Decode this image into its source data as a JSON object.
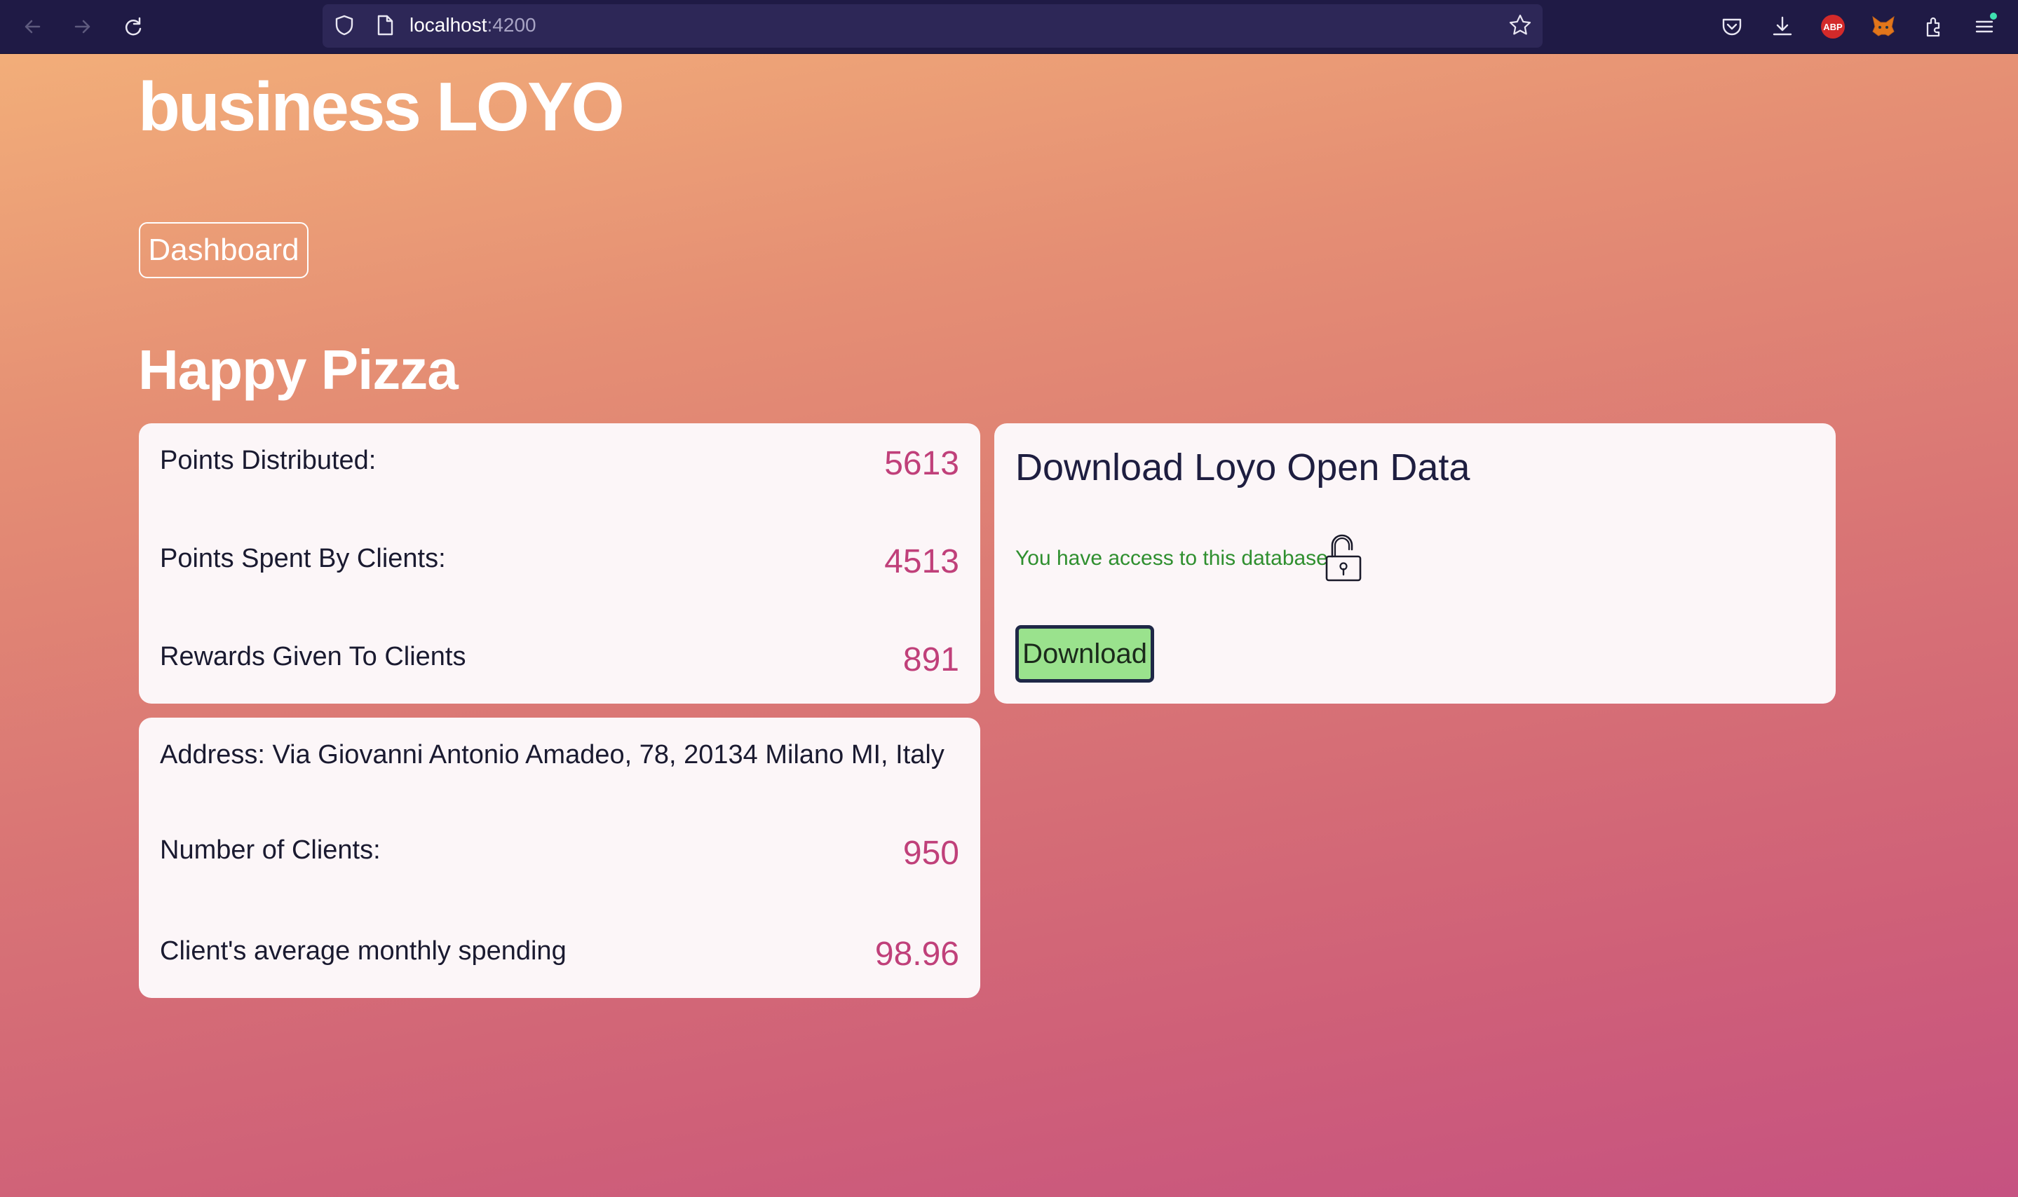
{
  "browser": {
    "url_host": "localhost",
    "url_port": ":4200",
    "icons": [
      "back-icon",
      "forward-icon",
      "reload-icon",
      "shield-icon",
      "page-icon",
      "star-icon",
      "pocket-icon",
      "download-icon",
      "adblock-icon",
      "fox-icon",
      "extensions-icon",
      "menu-icon"
    ],
    "adblock_label": "ABP"
  },
  "page": {
    "brand": "business LOYO",
    "dashboard_label": "Dashboard",
    "store_name": "Happy Pizza"
  },
  "points_card": {
    "rows": [
      {
        "label": "Points Distributed:",
        "value": "5613"
      },
      {
        "label": "Points Spent By Clients:",
        "value": "4513"
      },
      {
        "label": "Rewards Given To Clients",
        "value": "891"
      }
    ]
  },
  "info_card": {
    "address": "Address: Via Giovanni Antonio Amadeo, 78, 20134 Milano MI, Italy",
    "rows": [
      {
        "label": "Number of Clients:",
        "value": "950"
      },
      {
        "label": "Client's average monthly spending",
        "value": "98.96"
      }
    ]
  },
  "download_card": {
    "title": "Download Loyo Open Data",
    "access_text": "You have access to this database",
    "button_label": "Download"
  },
  "colors": {
    "accent_value": "#c0407a",
    "access_green": "#2f8f2f",
    "download_button": "#9ae28d",
    "toolbar": "#1f1a45"
  }
}
